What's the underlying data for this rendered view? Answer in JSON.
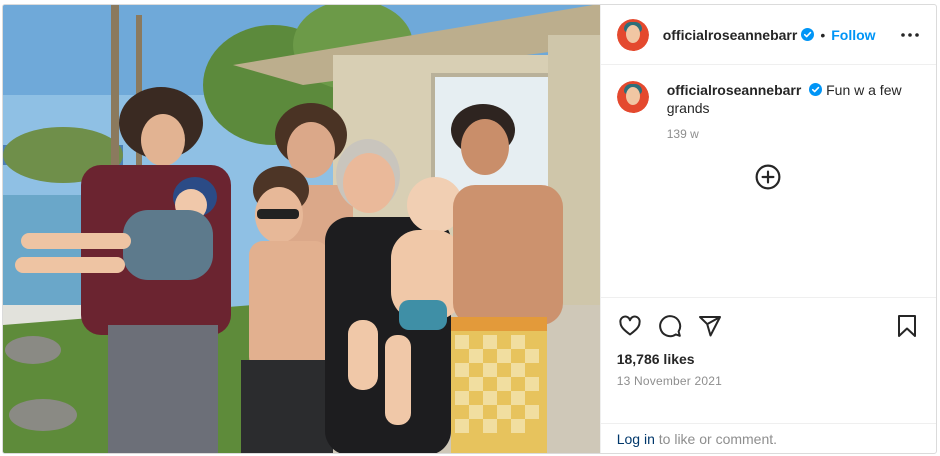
{
  "post": {
    "photo_alt": "Family photo",
    "username": "officialroseannebarr",
    "follow_label": "Follow",
    "separator": "•",
    "caption": "Fun w a few grands",
    "age": "139 w",
    "likes": "18,786 likes",
    "date": "13 November 2021"
  },
  "footer": {
    "login_link": "Log in",
    "login_rest": " to like or comment."
  },
  "colors": {
    "follow_blue": "#0095f6",
    "verified_blue": "#0095f6",
    "link_dark": "#00376b",
    "muted": "#8e8e8e"
  },
  "icons": [
    "verified-badge-icon",
    "more-options-icon",
    "add-comment-icon",
    "heart-icon",
    "comment-icon",
    "share-icon",
    "bookmark-icon"
  ]
}
